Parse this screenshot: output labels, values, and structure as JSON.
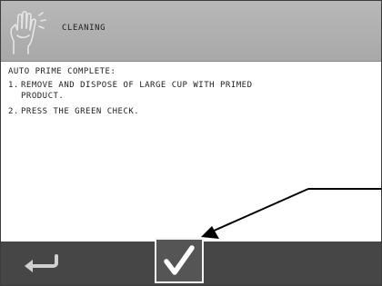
{
  "header": {
    "title": "CLEANING",
    "icon": "cleaning-hand-icon"
  },
  "content": {
    "heading": "AUTO PRIME COMPLETE:",
    "steps": [
      {
        "number": "1.",
        "text": "REMOVE AND DISPOSE OF LARGE CUP WITH PRIMED PRODUCT."
      },
      {
        "number": "2.",
        "text": "PRESS THE GREEN CHECK."
      }
    ]
  },
  "footer": {
    "back_icon": "back-arrow-icon",
    "confirm_icon": "check-icon"
  },
  "colors": {
    "header_bg": "#b0b0b0",
    "footer_bg": "#464646",
    "check_border": "#f4f4f4",
    "icon_light": "#e8e8e8",
    "annotation": "#000000"
  }
}
